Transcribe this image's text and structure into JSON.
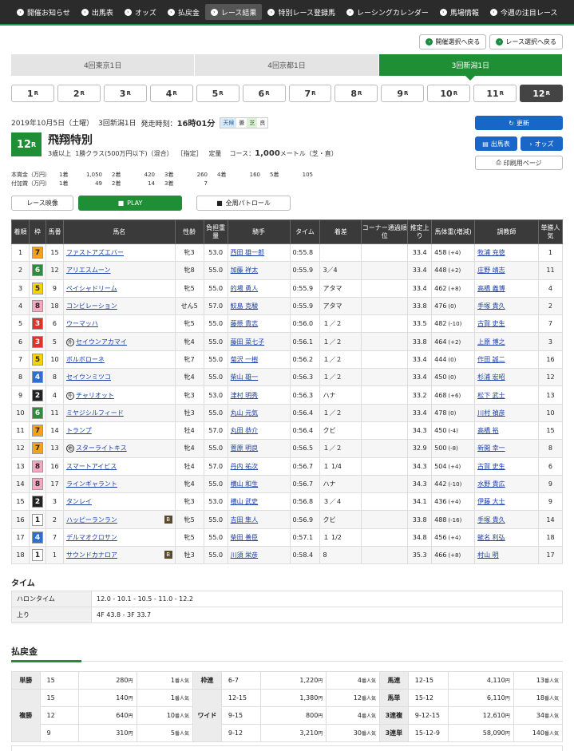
{
  "nav": [
    {
      "label": "開催お知らせ"
    },
    {
      "label": "出馬表"
    },
    {
      "label": "オッズ"
    },
    {
      "label": "払戻金"
    },
    {
      "label": "レース結果",
      "active": true
    },
    {
      "label": "特別レース登録馬"
    },
    {
      "label": "レーシングカレンダー"
    },
    {
      "label": "馬場情報"
    },
    {
      "label": "今週の注目レース"
    }
  ],
  "top_buttons": {
    "venue_back": "開催選択へ戻る",
    "race_back": "レース選択へ戻る"
  },
  "venues": [
    {
      "label": "4回東京1日"
    },
    {
      "label": "4回京都1日"
    },
    {
      "label": "3回新潟1日",
      "active": true
    }
  ],
  "races": [
    "1",
    "2",
    "3",
    "4",
    "5",
    "6",
    "7",
    "8",
    "9",
    "10",
    "11",
    "12"
  ],
  "race_unit": "R",
  "active_race": "12",
  "race": {
    "date": "2019年10月5日（土曜）",
    "meeting": "3回新潟1日",
    "post_label": "発走時刻：",
    "post_time": "16時01分",
    "weather_label": "天候",
    "weather": "曇",
    "turf_label": "芝",
    "turf": "良",
    "number": "12",
    "number_unit": "R",
    "name": "飛翔特別",
    "cond1": "3歳以上",
    "cond2": "1勝クラス(500万円以下)",
    "cond3": "（混合）",
    "cond4": "［指定］",
    "cond5": "定量",
    "course_label": "コース：",
    "distance": "1,000",
    "distance_unit": "メートル",
    "surface": "（芝・直）"
  },
  "prize": {
    "r1_label": "本賞金（万円）",
    "r2_label": "付加賞（万円）",
    "places": [
      "1着",
      "2着",
      "3着",
      "4着",
      "5着"
    ],
    "main": [
      "1,050",
      "420",
      "260",
      "160",
      "105"
    ],
    "extra": [
      "49",
      "14",
      "7"
    ]
  },
  "side_buttons": {
    "refresh": "更新",
    "entries": "出馬表",
    "odds": "オッズ",
    "print": "印刷用ページ"
  },
  "video": {
    "label": "レース映像",
    "play": "PLAY",
    "patrol": "全周パトロール"
  },
  "table": {
    "headers": [
      "着順",
      "枠",
      "馬番",
      "馬名",
      "性齢",
      "負担重量",
      "騎手",
      "タイム",
      "着差",
      "コーナー通過順位",
      "推定上り",
      "馬体重(増減)",
      "調教師",
      "単勝人気"
    ],
    "rows": [
      {
        "rank": "1",
        "waku": "7",
        "num": "15",
        "name": "ファストアズエバー",
        "mark": "",
        "blinker": "",
        "sex": "牝3",
        "wt": "53.0",
        "jockey": "西田 雄一郎",
        "time": "0:55.8",
        "diff": "",
        "agari": "33.4",
        "body": "458",
        "chg": "(+4)",
        "trainer": "牧浦 充徳",
        "pop": "1"
      },
      {
        "rank": "2",
        "waku": "6",
        "num": "12",
        "name": "アリエスムーン",
        "mark": "",
        "blinker": "",
        "sex": "牝8",
        "wt": "55.0",
        "jockey": "加藤 祥太",
        "time": "0:55.9",
        "diff": "3／4",
        "agari": "33.4",
        "body": "448",
        "chg": "(+2)",
        "trainer": "庄野 靖志",
        "pop": "11"
      },
      {
        "rank": "3",
        "waku": "5",
        "num": "9",
        "name": "ペイシャドリーム",
        "mark": "",
        "blinker": "",
        "sex": "牝5",
        "wt": "55.0",
        "jockey": "的場 勇人",
        "time": "0:55.9",
        "diff": "アタマ",
        "agari": "33.4",
        "body": "462",
        "chg": "(+8)",
        "trainer": "高橋 義博",
        "pop": "4"
      },
      {
        "rank": "4",
        "waku": "8",
        "num": "18",
        "name": "コンビレーション",
        "mark": "",
        "blinker": "",
        "sex": "せん5",
        "wt": "57.0",
        "jockey": "鮫島 克駿",
        "time": "0:55.9",
        "diff": "アタマ",
        "agari": "33.8",
        "body": "476",
        "chg": "(0)",
        "trainer": "手塚 貴久",
        "pop": "2"
      },
      {
        "rank": "5",
        "waku": "3",
        "num": "6",
        "name": "ウーマッハ",
        "mark": "",
        "blinker": "",
        "sex": "牝5",
        "wt": "55.0",
        "jockey": "藤懸 貴志",
        "time": "0:56.0",
        "diff": "１／２",
        "agari": "33.5",
        "body": "482",
        "chg": "(-10)",
        "trainer": "古賀 史生",
        "pop": "7"
      },
      {
        "rank": "6",
        "waku": "3",
        "num": "5",
        "name": "セイウンアカマイ",
        "mark": "外",
        "blinker": "",
        "sex": "牝4",
        "wt": "55.0",
        "jockey": "藤田 菜七子",
        "time": "0:56.1",
        "diff": "１／２",
        "agari": "33.8",
        "body": "464",
        "chg": "(+2)",
        "trainer": "上原 博之",
        "pop": "3"
      },
      {
        "rank": "7",
        "waku": "5",
        "num": "10",
        "name": "ボルボローネ",
        "mark": "",
        "blinker": "",
        "sex": "牝7",
        "wt": "55.0",
        "jockey": "菊沢 一樹",
        "time": "0:56.2",
        "diff": "１／２",
        "agari": "33.4",
        "body": "444",
        "chg": "(0)",
        "trainer": "作田 誠二",
        "pop": "16"
      },
      {
        "rank": "8",
        "waku": "4",
        "num": "8",
        "name": "セイウンミツコ",
        "mark": "",
        "blinker": "",
        "sex": "牝4",
        "wt": "55.0",
        "jockey": "柴山 雄一",
        "time": "0:56.3",
        "diff": "１／２",
        "agari": "33.4",
        "body": "450",
        "chg": "(0)",
        "trainer": "杉浦 宏昭",
        "pop": "12"
      },
      {
        "rank": "9",
        "waku": "2",
        "num": "4",
        "name": "チャリオット",
        "mark": "外",
        "blinker": "",
        "sex": "牝3",
        "wt": "53.0",
        "jockey": "津村 明秀",
        "time": "0:56.3",
        "diff": "ハナ",
        "agari": "33.2",
        "body": "468",
        "chg": "(+6)",
        "trainer": "松下 武士",
        "pop": "13"
      },
      {
        "rank": "10",
        "waku": "6",
        "num": "11",
        "name": "ミヤジシルフィード",
        "mark": "",
        "blinker": "",
        "sex": "牡3",
        "wt": "55.0",
        "jockey": "丸山 元気",
        "time": "0:56.4",
        "diff": "１／２",
        "agari": "33.4",
        "body": "478",
        "chg": "(0)",
        "trainer": "川村 禎彦",
        "pop": "10"
      },
      {
        "rank": "11",
        "waku": "7",
        "num": "14",
        "name": "トランプ",
        "mark": "",
        "blinker": "",
        "sex": "牡4",
        "wt": "57.0",
        "jockey": "丸田 恭介",
        "time": "0:56.4",
        "diff": "クビ",
        "agari": "34.3",
        "body": "450",
        "chg": "(-4)",
        "trainer": "高橋 裕",
        "pop": "15"
      },
      {
        "rank": "12",
        "waku": "7",
        "num": "13",
        "name": "スターライトキス",
        "mark": "地",
        "blinker": "",
        "sex": "牝4",
        "wt": "55.0",
        "jockey": "菅原 明良",
        "time": "0:56.5",
        "diff": "１／２",
        "agari": "32.9",
        "body": "500",
        "chg": "(-8)",
        "trainer": "新開 幸一",
        "pop": "8"
      },
      {
        "rank": "13",
        "waku": "8",
        "num": "16",
        "name": "スマートアイビス",
        "mark": "",
        "blinker": "",
        "sex": "牡4",
        "wt": "57.0",
        "jockey": "丹内 祐次",
        "time": "0:56.7",
        "diff": "１ 1/4",
        "agari": "34.3",
        "body": "504",
        "chg": "(+4)",
        "trainer": "古賀 史生",
        "pop": "6"
      },
      {
        "rank": "14",
        "waku": "8",
        "num": "17",
        "name": "ラインギャラント",
        "mark": "",
        "blinker": "",
        "sex": "牝4",
        "wt": "55.0",
        "jockey": "横山 和生",
        "time": "0:56.7",
        "diff": "ハナ",
        "agari": "34.3",
        "body": "442",
        "chg": "(-10)",
        "trainer": "水野 貴広",
        "pop": "9"
      },
      {
        "rank": "15",
        "waku": "2",
        "num": "3",
        "name": "タンレイ",
        "mark": "",
        "blinker": "",
        "sex": "牝3",
        "wt": "53.0",
        "jockey": "横山 武史",
        "time": "0:56.8",
        "diff": "３／４",
        "agari": "34.1",
        "body": "436",
        "chg": "(+4)",
        "trainer": "伊藤 大士",
        "pop": "9"
      },
      {
        "rank": "16",
        "waku": "1",
        "num": "2",
        "name": "ハッピーランラン",
        "mark": "",
        "blinker": "B",
        "sex": "牝5",
        "wt": "55.0",
        "jockey": "吉田 隼人",
        "time": "0:56.9",
        "diff": "クビ",
        "agari": "33.8",
        "body": "488",
        "chg": "(-16)",
        "trainer": "手塚 貴久",
        "pop": "14"
      },
      {
        "rank": "17",
        "waku": "4",
        "num": "7",
        "name": "デルマオクロサン",
        "mark": "",
        "blinker": "",
        "sex": "牝5",
        "wt": "55.0",
        "jockey": "柴田 善臣",
        "time": "0:57.1",
        "diff": "１ 1/2",
        "agari": "34.8",
        "body": "456",
        "chg": "(+4)",
        "trainer": "蛯名 利弘",
        "pop": "18"
      },
      {
        "rank": "18",
        "waku": "1",
        "num": "1",
        "name": "サウンドカナロア",
        "mark": "",
        "blinker": "B",
        "sex": "牡3",
        "wt": "55.0",
        "jockey": "川須 栄彦",
        "time": "0:58.4",
        "diff": "8",
        "agari": "35.3",
        "body": "466",
        "chg": "(+8)",
        "trainer": "村山 明",
        "pop": "17"
      }
    ]
  },
  "time_section": {
    "title": "タイム",
    "rows": [
      {
        "label": "ハロンタイム",
        "value": "12.0 - 10.1 - 10.5 - 11.0 - 12.2"
      },
      {
        "label": "上り",
        "value": "4F 43.8 - 3F 33.7"
      }
    ]
  },
  "payout": {
    "title": "払戻金",
    "yen": "円",
    "ninki": "番人気",
    "tansho": {
      "label": "単勝",
      "combo": "15",
      "amount": "280",
      "pop": "1"
    },
    "fukusho": {
      "label": "複勝",
      "rows": [
        {
          "combo": "15",
          "amount": "140",
          "pop": "1"
        },
        {
          "combo": "12",
          "amount": "640",
          "pop": "10"
        },
        {
          "combo": "9",
          "amount": "310",
          "pop": "5"
        }
      ]
    },
    "wakuren": {
      "label": "枠連",
      "combo": "6-7",
      "amount": "1,220",
      "pop": "4"
    },
    "wide": {
      "label": "ワイド",
      "rows": [
        {
          "combo": "12-15",
          "amount": "1,380",
          "pop": "12"
        },
        {
          "combo": "9-15",
          "amount": "800",
          "pop": "4"
        },
        {
          "combo": "9-12",
          "amount": "3,210",
          "pop": "30"
        }
      ]
    },
    "umaren": {
      "label": "馬連",
      "combo": "12-15",
      "amount": "4,110",
      "pop": "13"
    },
    "umatan": {
      "label": "馬単",
      "combo": "15-12",
      "amount": "6,110",
      "pop": "18"
    },
    "sanrenpuku": {
      "label": "3連複",
      "combo": "9-12-15",
      "amount": "12,610",
      "pop": "34"
    },
    "sanrentan": {
      "label": "3連単",
      "combo": "15-12-9",
      "amount": "58,090",
      "pop": "140"
    }
  },
  "colors": {
    "green": "#1e8f35",
    "blue": "#1766c8",
    "waku": {
      "1": "#ffffff",
      "2": "#222222",
      "3": "#e0322b",
      "4": "#2c6fcf",
      "5": "#f5d400",
      "6": "#2e8b3c",
      "7": "#f7a11a",
      "8": "#f5a9c0"
    }
  }
}
